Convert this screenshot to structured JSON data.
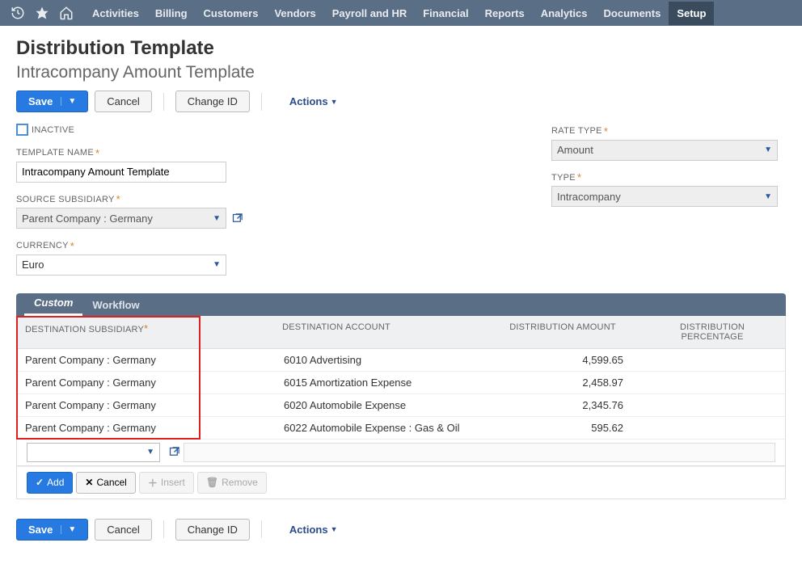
{
  "nav": {
    "items": [
      "Activities",
      "Billing",
      "Customers",
      "Vendors",
      "Payroll and HR",
      "Financial",
      "Reports",
      "Analytics",
      "Documents",
      "Setup"
    ],
    "active_index": 9
  },
  "page": {
    "title": "Distribution Template",
    "subtitle": "Intracompany Amount Template"
  },
  "buttons": {
    "save": "Save",
    "cancel": "Cancel",
    "change_id": "Change ID",
    "actions": "Actions"
  },
  "form": {
    "inactive_label": "INACTIVE",
    "inactive_checked": false,
    "template_name_label": "TEMPLATE NAME",
    "template_name_value": "Intracompany Amount Template",
    "source_subsidiary_label": "SOURCE SUBSIDIARY",
    "source_subsidiary_value": "Parent Company : Germany",
    "currency_label": "CURRENCY",
    "currency_value": "Euro",
    "rate_type_label": "RATE TYPE",
    "rate_type_value": "Amount",
    "type_label": "TYPE",
    "type_value": "Intracompany"
  },
  "tabs": {
    "items": [
      "Custom",
      "Workflow"
    ],
    "active_index": 0
  },
  "grid": {
    "headers": {
      "subsidiary": "DESTINATION SUBSIDIARY",
      "account": "DESTINATION ACCOUNT",
      "amount": "DISTRIBUTION AMOUNT",
      "percentage": "DISTRIBUTION PERCENTAGE"
    },
    "rows": [
      {
        "subsidiary": "Parent Company : Germany",
        "account": "6010 Advertising",
        "amount": "4,599.65",
        "percentage": ""
      },
      {
        "subsidiary": "Parent Company : Germany",
        "account": "6015 Amortization Expense",
        "amount": "2,458.97",
        "percentage": ""
      },
      {
        "subsidiary": "Parent Company : Germany",
        "account": "6020 Automobile Expense",
        "amount": "2,345.76",
        "percentage": ""
      },
      {
        "subsidiary": "Parent Company : Germany",
        "account": "6022 Automobile Expense : Gas & Oil",
        "amount": "595.62",
        "percentage": ""
      }
    ],
    "buttons": {
      "add": "Add",
      "cancel": "Cancel",
      "insert": "Insert",
      "remove": "Remove"
    }
  }
}
